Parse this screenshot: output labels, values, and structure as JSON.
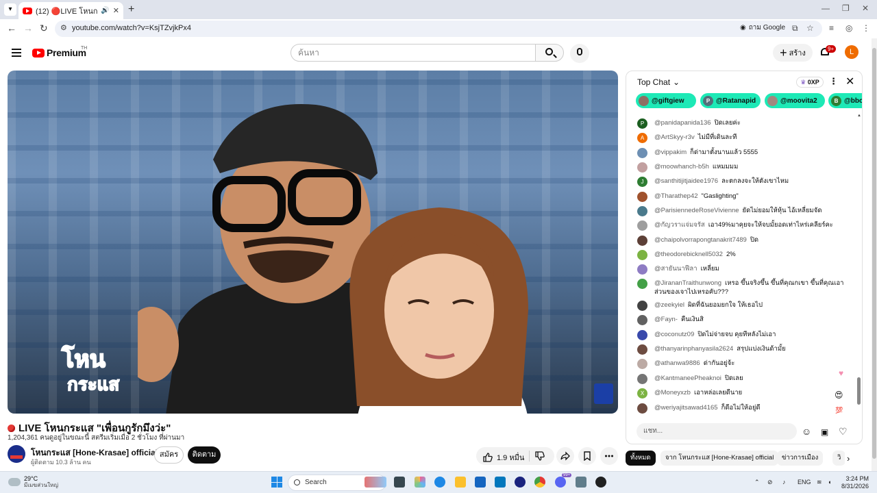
{
  "browser": {
    "tab_title": "(12) 🔴LIVE โหนกระแส \"เพื่อน",
    "url": "youtube.com/watch?v=KsjTZvjkPx4",
    "google_lens_label": "ถาม Google"
  },
  "header": {
    "logo_text": "Premium",
    "logo_region": "TH",
    "search_placeholder": "ค้นหา",
    "create_label": "สร้าง",
    "notifications_badge": "9+",
    "avatar_initial": "L"
  },
  "video": {
    "title": "LIVE โหนกระแส \"เพื่อนกูรักมึงว่ะ\"",
    "meta": "1,204,361 คนดูอยู่ในขณะนี้  สตรีมเริ่มเมื่อ 2 ชั่วโมง ที่ผ่านมา",
    "channel_name": "โหนกระแส [Hone-Krasae] official",
    "subscribers": "ผู้ติดตาม 10.3 ล้าน คน",
    "join_label": "สมัคร",
    "subscribe_label": "ติดตาม",
    "likes": "1.9 หมื่น"
  },
  "chat": {
    "header": "Top Chat",
    "xp_label": "0XP",
    "input_placeholder": "แชท...",
    "tickers": [
      {
        "name": "@giftgiew",
        "initial": "",
        "color": "#8d6e63"
      },
      {
        "name": "@Ratanapid",
        "initial": "P",
        "color": "#546e7a"
      },
      {
        "name": "@moovita2",
        "initial": "",
        "color": "#a1887f"
      },
      {
        "name": "@bboy",
        "initial": "B",
        "color": "#2e7d32"
      }
    ],
    "messages": [
      {
        "author": "@panidapanida136",
        "text": "ปิดเลยค่ะ",
        "initial": "P",
        "color": "#1b5e20"
      },
      {
        "author": "@ArtSkyy-r3v",
        "text": "ไม่มีที่เดินละที",
        "initial": "A",
        "color": "#ef6c00"
      },
      {
        "author": "@vippakim",
        "text": "ก็ด่ามาตั้งนานแล้ว 5555",
        "initial": "",
        "color": "#6d8fb3"
      },
      {
        "author": "@moowhanch-b5h",
        "text": "แหมมมม",
        "initial": "",
        "color": "#c2a0a0"
      },
      {
        "author": "@santhitijitjaidee1976",
        "text": "ละตกลงจะให้ตังเขาไหม",
        "initial": "J",
        "color": "#2e7d32"
      },
      {
        "author": "@Tharathep42",
        "text": "\"Gaslighting\"",
        "initial": "",
        "color": "#a0522d"
      },
      {
        "author": "@ParisiennedeRoseVivienne",
        "text": "ยัดไม่ยอมให้หุ้น ไอ้เหลี่ยมจัด",
        "initial": "",
        "color": "#4a7a8c"
      },
      {
        "author": "@กัญวราแจ่มจรัส",
        "text": "เอา49%มาคุยจะให้จบมั้ยอดเท่าไหร่เคลียร์คะ",
        "initial": "",
        "color": "#9e9e9e"
      },
      {
        "author": "@chaipolvorrapongtanakrit7489",
        "text": "ปิด",
        "initial": "",
        "color": "#5d4037"
      },
      {
        "author": "@theodorebicknell5032",
        "text": "2%",
        "initial": "",
        "color": "#7cb342"
      },
      {
        "author": "@สายันนาฟีลา",
        "text": "เหลี่ยม",
        "initial": "",
        "color": "#8e7cc3"
      },
      {
        "author": "@JirananTraithunwong",
        "text": "เหรอ ขึ้นจริงขึ้น ขึ้นที่คุณกเขา ขึ้นที่คุณเอาส่วนของเจาไปเหรอคับ???",
        "initial": "",
        "color": "#43a047"
      },
      {
        "author": "@zeekyiel",
        "text": "ผิดที่ฉันยอมยกใจ ให้เธอไป",
        "initial": "",
        "color": "#424242"
      },
      {
        "author": "@Fayn-",
        "text": "คืนเงินสิ",
        "initial": "",
        "color": "#616161"
      },
      {
        "author": "@coconutz09",
        "text": "ปิดไม่จ่ายจบ คุยทีหลังไม่เอา",
        "initial": "",
        "color": "#3949ab"
      },
      {
        "author": "@thanyarinphanyasila2624",
        "text": "สรุปแบ่งเงินด้ามั้ย",
        "initial": "",
        "color": "#6d4c41"
      },
      {
        "author": "@athanwa9886",
        "text": "ด่ากันอยู่จ้ะ",
        "initial": "",
        "color": "#bcaaa4"
      },
      {
        "author": "@KantmaneePheaknoi",
        "text": "ปิดเลย",
        "initial": "",
        "color": "#757575"
      },
      {
        "author": "@Moneyxzb",
        "text": "เอาหล่อเลยดีนาย",
        "initial": "X",
        "color": "#7cb342"
      },
      {
        "author": "@weriyajitsawad4165",
        "text": "ก็ดีอไม่ให้อยู่ดี",
        "initial": "",
        "color": "#6d4c41"
      }
    ]
  },
  "chips": [
    "ทั้งหมด",
    "จาก โหนกระแส [Hone-Krasae] official",
    "ข่าวการเมือง",
    "วิ"
  ],
  "taskbar": {
    "weather_temp": "29°C",
    "weather_desc": "มีเมฆส่วนใหญ่",
    "search_label": "Search",
    "language": "ENG",
    "time": "3:24 PM",
    "date": "8/31/2026",
    "chat_badge": "99+"
  },
  "overlay": {
    "program_logo_line1": "โหน",
    "program_logo_line2": "กระแส"
  }
}
